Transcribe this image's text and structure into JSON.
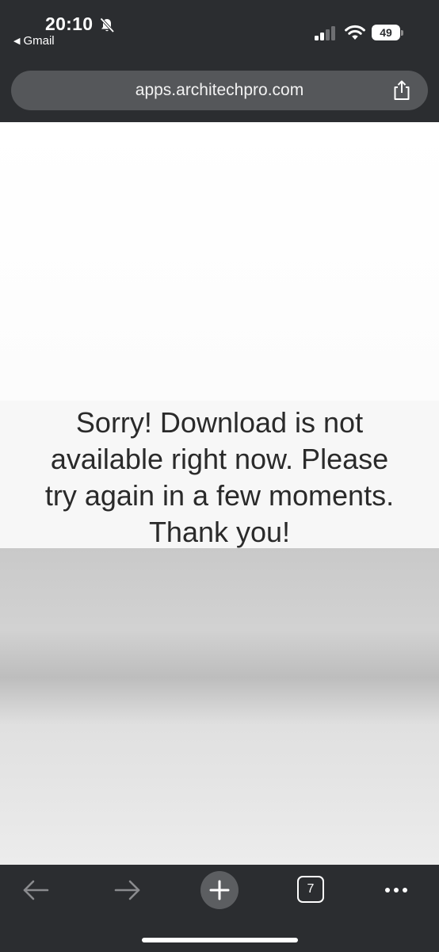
{
  "status_bar": {
    "time": "20:10",
    "back_app": "Gmail",
    "battery_level": "49"
  },
  "address_bar": {
    "url": "apps.architechpro.com"
  },
  "page": {
    "message_lines": [
      "Sorry! Download is not",
      "available right now. Please",
      "try again in a few moments.",
      "Thank you!"
    ]
  },
  "toolbar": {
    "tab_count": "7"
  },
  "colors": {
    "chrome_background": "#2b2d30",
    "url_bar_background": "#55575a",
    "message_text": "#2a2a2a"
  }
}
